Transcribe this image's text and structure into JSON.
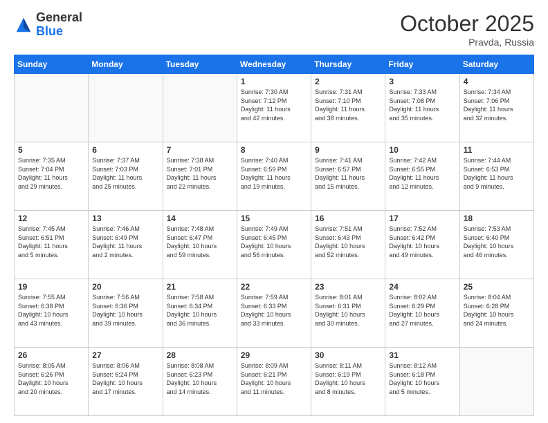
{
  "header": {
    "logo_general": "General",
    "logo_blue": "Blue",
    "title": "October 2025",
    "location": "Pravda, Russia"
  },
  "days_of_week": [
    "Sunday",
    "Monday",
    "Tuesday",
    "Wednesday",
    "Thursday",
    "Friday",
    "Saturday"
  ],
  "weeks": [
    [
      {
        "day": "",
        "info": ""
      },
      {
        "day": "",
        "info": ""
      },
      {
        "day": "",
        "info": ""
      },
      {
        "day": "1",
        "info": "Sunrise: 7:30 AM\nSunset: 7:12 PM\nDaylight: 11 hours\nand 42 minutes."
      },
      {
        "day": "2",
        "info": "Sunrise: 7:31 AM\nSunset: 7:10 PM\nDaylight: 11 hours\nand 38 minutes."
      },
      {
        "day": "3",
        "info": "Sunrise: 7:33 AM\nSunset: 7:08 PM\nDaylight: 11 hours\nand 35 minutes."
      },
      {
        "day": "4",
        "info": "Sunrise: 7:34 AM\nSunset: 7:06 PM\nDaylight: 11 hours\nand 32 minutes."
      }
    ],
    [
      {
        "day": "5",
        "info": "Sunrise: 7:35 AM\nSunset: 7:04 PM\nDaylight: 11 hours\nand 29 minutes."
      },
      {
        "day": "6",
        "info": "Sunrise: 7:37 AM\nSunset: 7:03 PM\nDaylight: 11 hours\nand 25 minutes."
      },
      {
        "day": "7",
        "info": "Sunrise: 7:38 AM\nSunset: 7:01 PM\nDaylight: 11 hours\nand 22 minutes."
      },
      {
        "day": "8",
        "info": "Sunrise: 7:40 AM\nSunset: 6:59 PM\nDaylight: 11 hours\nand 19 minutes."
      },
      {
        "day": "9",
        "info": "Sunrise: 7:41 AM\nSunset: 6:57 PM\nDaylight: 11 hours\nand 15 minutes."
      },
      {
        "day": "10",
        "info": "Sunrise: 7:42 AM\nSunset: 6:55 PM\nDaylight: 11 hours\nand 12 minutes."
      },
      {
        "day": "11",
        "info": "Sunrise: 7:44 AM\nSunset: 6:53 PM\nDaylight: 11 hours\nand 9 minutes."
      }
    ],
    [
      {
        "day": "12",
        "info": "Sunrise: 7:45 AM\nSunset: 6:51 PM\nDaylight: 11 hours\nand 5 minutes."
      },
      {
        "day": "13",
        "info": "Sunrise: 7:46 AM\nSunset: 6:49 PM\nDaylight: 11 hours\nand 2 minutes."
      },
      {
        "day": "14",
        "info": "Sunrise: 7:48 AM\nSunset: 6:47 PM\nDaylight: 10 hours\nand 59 minutes."
      },
      {
        "day": "15",
        "info": "Sunrise: 7:49 AM\nSunset: 6:45 PM\nDaylight: 10 hours\nand 56 minutes."
      },
      {
        "day": "16",
        "info": "Sunrise: 7:51 AM\nSunset: 6:43 PM\nDaylight: 10 hours\nand 52 minutes."
      },
      {
        "day": "17",
        "info": "Sunrise: 7:52 AM\nSunset: 6:42 PM\nDaylight: 10 hours\nand 49 minutes."
      },
      {
        "day": "18",
        "info": "Sunrise: 7:53 AM\nSunset: 6:40 PM\nDaylight: 10 hours\nand 46 minutes."
      }
    ],
    [
      {
        "day": "19",
        "info": "Sunrise: 7:55 AM\nSunset: 6:38 PM\nDaylight: 10 hours\nand 43 minutes."
      },
      {
        "day": "20",
        "info": "Sunrise: 7:56 AM\nSunset: 6:36 PM\nDaylight: 10 hours\nand 39 minutes."
      },
      {
        "day": "21",
        "info": "Sunrise: 7:58 AM\nSunset: 6:34 PM\nDaylight: 10 hours\nand 36 minutes."
      },
      {
        "day": "22",
        "info": "Sunrise: 7:59 AM\nSunset: 6:33 PM\nDaylight: 10 hours\nand 33 minutes."
      },
      {
        "day": "23",
        "info": "Sunrise: 8:01 AM\nSunset: 6:31 PM\nDaylight: 10 hours\nand 30 minutes."
      },
      {
        "day": "24",
        "info": "Sunrise: 8:02 AM\nSunset: 6:29 PM\nDaylight: 10 hours\nand 27 minutes."
      },
      {
        "day": "25",
        "info": "Sunrise: 8:04 AM\nSunset: 6:28 PM\nDaylight: 10 hours\nand 24 minutes."
      }
    ],
    [
      {
        "day": "26",
        "info": "Sunrise: 8:05 AM\nSunset: 6:26 PM\nDaylight: 10 hours\nand 20 minutes."
      },
      {
        "day": "27",
        "info": "Sunrise: 8:06 AM\nSunset: 6:24 PM\nDaylight: 10 hours\nand 17 minutes."
      },
      {
        "day": "28",
        "info": "Sunrise: 8:08 AM\nSunset: 6:23 PM\nDaylight: 10 hours\nand 14 minutes."
      },
      {
        "day": "29",
        "info": "Sunrise: 8:09 AM\nSunset: 6:21 PM\nDaylight: 10 hours\nand 11 minutes."
      },
      {
        "day": "30",
        "info": "Sunrise: 8:11 AM\nSunset: 6:19 PM\nDaylight: 10 hours\nand 8 minutes."
      },
      {
        "day": "31",
        "info": "Sunrise: 8:12 AM\nSunset: 6:18 PM\nDaylight: 10 hours\nand 5 minutes."
      },
      {
        "day": "",
        "info": ""
      }
    ]
  ]
}
